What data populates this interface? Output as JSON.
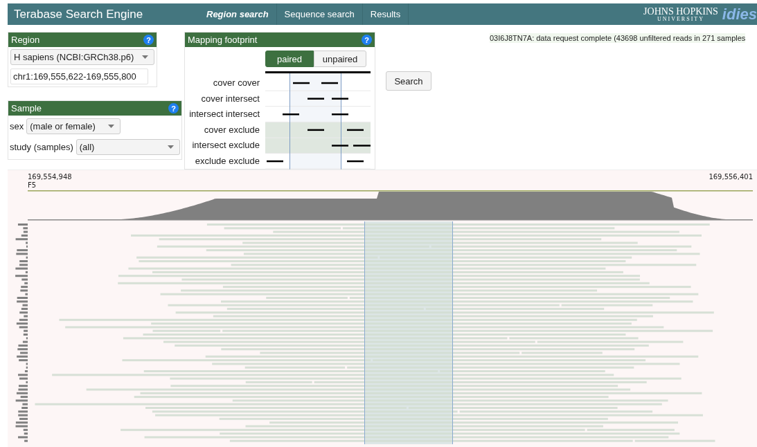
{
  "header": {
    "title": "Terabase Search Engine",
    "nav": [
      {
        "label": "Region search",
        "selected": true
      },
      {
        "label": "Sequence search",
        "selected": false
      },
      {
        "label": "Results",
        "selected": false
      }
    ],
    "logo": {
      "name": "JOHNS HOPKINS",
      "sub": "UNIVERSITY",
      "mark": "idies"
    }
  },
  "region": {
    "title": "Region",
    "help": "?",
    "assembly": "H sapiens (NCBI:GRCh38.p6)",
    "locus": "chr1:169,555,622-169,555,800"
  },
  "sample": {
    "title": "Sample",
    "help": "?",
    "fields": [
      {
        "label": "sex",
        "value": "(male or female)"
      },
      {
        "label": "study (samples)",
        "value": "(all)"
      }
    ]
  },
  "footprint": {
    "title": "Mapping footprint",
    "help": "?",
    "modes": [
      {
        "label": "paired",
        "selected": true
      },
      {
        "label": "unpaired",
        "selected": false
      }
    ],
    "rows": [
      {
        "label": "cover cover",
        "shaded": false
      },
      {
        "label": "cover intersect",
        "shaded": false
      },
      {
        "label": "intersect intersect",
        "shaded": false
      },
      {
        "label": "cover exclude",
        "shaded": true
      },
      {
        "label": "intersect exclude",
        "shaded": true
      },
      {
        "label": "exclude exclude",
        "shaded": false
      }
    ]
  },
  "search_button": "Search",
  "status": "03I6J8TN7A: data request complete (43698 unfiltered reads in 271 samples",
  "track": {
    "start": "169,554,948",
    "end": "169,556,401",
    "gene": "F5"
  }
}
